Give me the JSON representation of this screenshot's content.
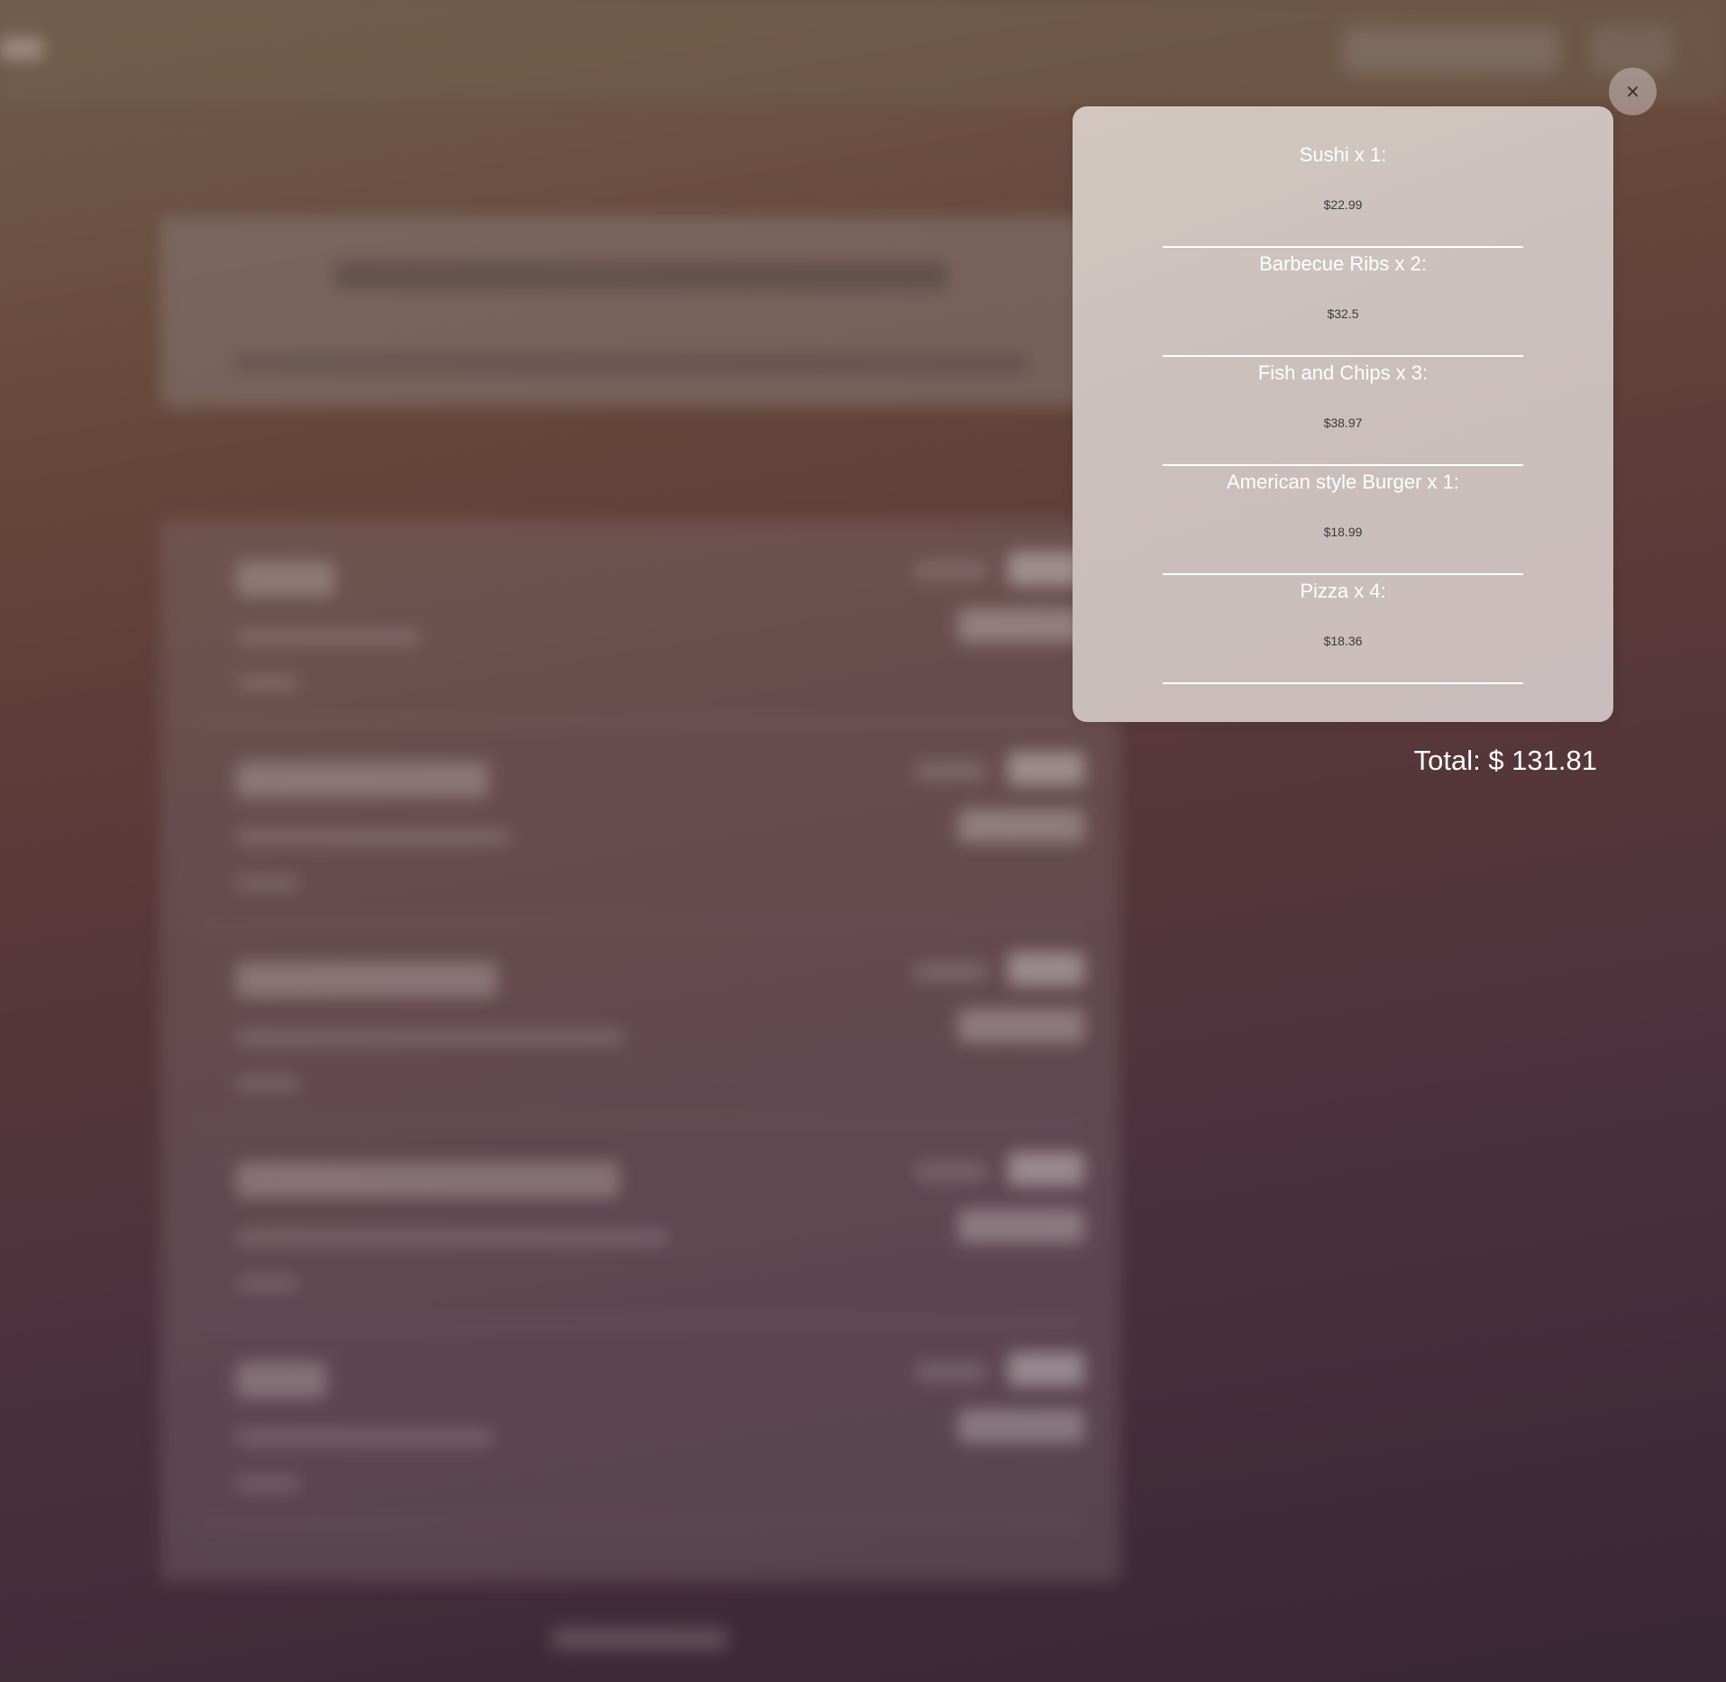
{
  "cart": {
    "close_label": "×",
    "items": [
      {
        "name": "Sushi x 1:",
        "price": "$22.99"
      },
      {
        "name": "Barbecue Ribs x 2:",
        "price": "$32.5"
      },
      {
        "name": "Fish and Chips x 3:",
        "price": "$38.97"
      },
      {
        "name": "American style Burger x 1:",
        "price": "$18.99"
      },
      {
        "name": "Pizza x 4:",
        "price": "$18.36"
      }
    ],
    "total": "Total: $ 131.81"
  }
}
